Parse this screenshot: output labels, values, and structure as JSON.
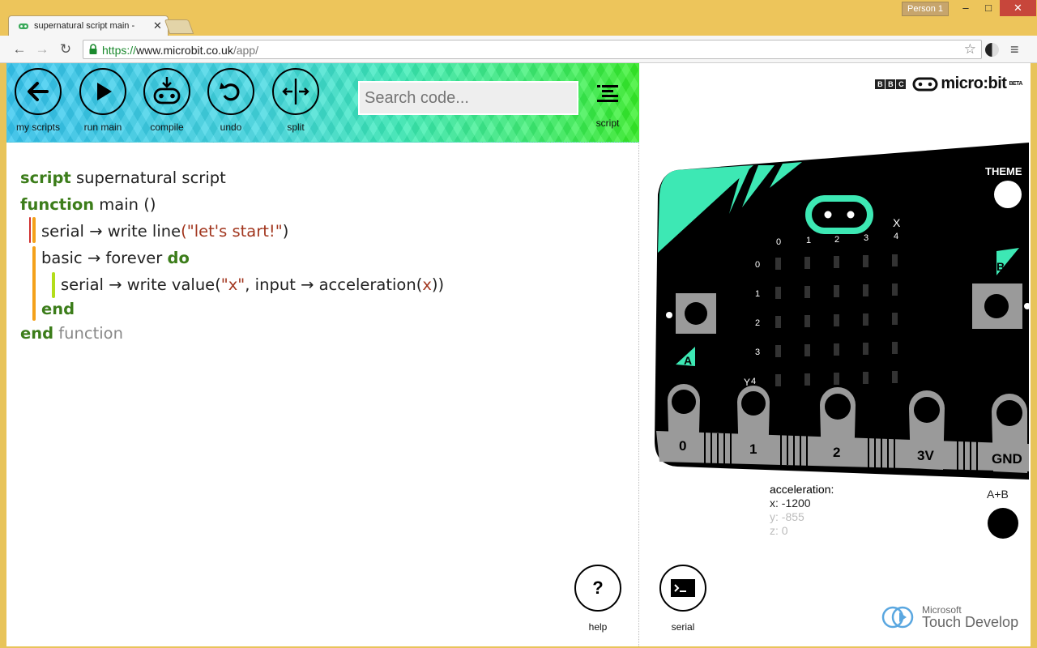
{
  "browser": {
    "tab_title": "supernatural script main -",
    "profile": "Person 1",
    "url_scheme": "https://",
    "url_host": "www.microbit.co.uk",
    "url_path": "/app/"
  },
  "hero": {
    "buttons": [
      {
        "label": "my scripts",
        "icon": "arrow-left-icon"
      },
      {
        "label": "run main",
        "icon": "play-icon"
      },
      {
        "label": "compile",
        "icon": "compile-icon"
      },
      {
        "label": "undo",
        "icon": "undo-icon"
      },
      {
        "label": "split",
        "icon": "split-icon"
      }
    ],
    "search_placeholder": "Search code...",
    "script_label": "script"
  },
  "code": {
    "l1_kw": "script",
    "l1_name": "supernatural script",
    "l2_kw": "function",
    "l2_name": "main ()",
    "l3_call": "serial → write line",
    "l3_open": "(",
    "l3_str": "\"let's start!\"",
    "l3_close": ")",
    "l4_call": "basic → forever",
    "l4_kw": "do",
    "l5_call": "serial → write value",
    "l5_open": "(",
    "l5_str": "\"x\"",
    "l5_mid": ", input → acceleration",
    "l5_open2": "(",
    "l5_arg": "x",
    "l5_close": "))",
    "l6_kw": "end",
    "l7_kw": "end",
    "l7_dim": "function"
  },
  "bottom": {
    "help_label": "help",
    "serial_label": "serial"
  },
  "simulator": {
    "brand": "micro:bit",
    "beta": "BETA",
    "bbc": [
      "B",
      "B",
      "C"
    ],
    "theme_label": "THEME",
    "col_labels": [
      "0",
      "1",
      "2",
      "3",
      "4"
    ],
    "row_labels": [
      "0",
      "1",
      "2",
      "3",
      "4"
    ],
    "axis_x": "X",
    "axis_y": "Y",
    "button_a": "A",
    "button_b": "B",
    "pins": [
      "0",
      "1",
      "2",
      "3V",
      "GND"
    ],
    "accel_title": "acceleration:",
    "accel_x": "x: -1200",
    "accel_y": "y: -855",
    "accel_z": "z: 0",
    "ab_label": "A+B",
    "td_microsoft": "Microsoft",
    "td_name": "Touch Develop"
  },
  "colors": {
    "keyword": "#3c7d1a",
    "string": "#a2371f",
    "accent_teal": "#3de8b4"
  }
}
